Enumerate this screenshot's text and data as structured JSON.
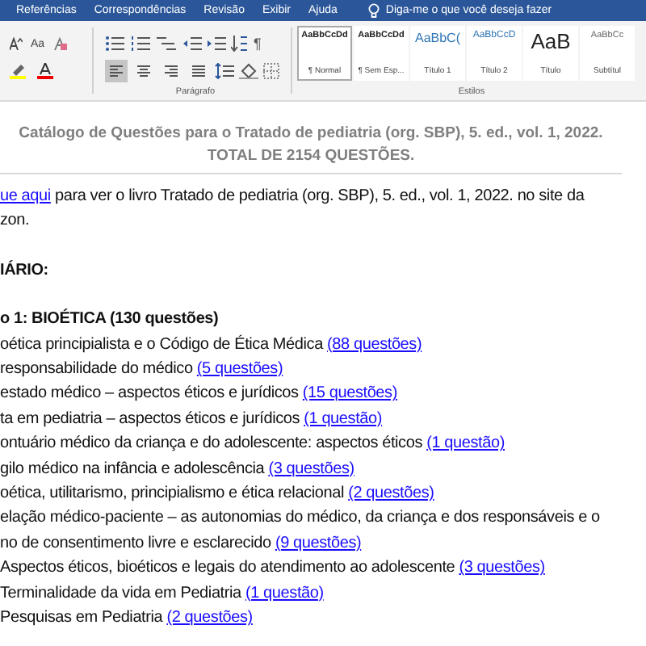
{
  "menu_tabs": [
    "Referências",
    "Correspondências",
    "Revisão",
    "Exibir",
    "Ajuda"
  ],
  "tell_me": {
    "placeholder": "Diga-me o que você deseja fazer"
  },
  "font_group": {
    "change_case": "Aa"
  },
  "paragraph_group": {
    "label": "Parágrafo",
    "show_marks": "¶",
    "alignment": [
      {
        "kind": "left",
        "selected": true
      },
      {
        "kind": "center",
        "selected": false
      },
      {
        "kind": "right",
        "selected": false
      },
      {
        "kind": "justify",
        "selected": false
      }
    ]
  },
  "styles_group": {
    "label": "Estilos",
    "items": [
      {
        "kind": "normal",
        "preview": "AaBbCcDd",
        "name": "¶ Normal",
        "selected": true
      },
      {
        "kind": "normal",
        "preview": "AaBbCcDd",
        "name": "¶ Sem Esp...",
        "selected": false
      },
      {
        "kind": "heading1",
        "preview": "AaBbC(",
        "name": "Título 1",
        "selected": false
      },
      {
        "kind": "heading2",
        "preview": "AaBbCcD",
        "name": "Título 2",
        "selected": false
      },
      {
        "kind": "title",
        "preview": "AaB",
        "name": "Título",
        "selected": false
      },
      {
        "kind": "subtitle",
        "preview": "AaBbCc",
        "name": "Subtítul",
        "selected": false
      }
    ]
  },
  "document": {
    "title_lines": [
      "Catálogo de Questões para o Tratado de pediatria (org. SBP), 5. ed., vol. 1, 2022.",
      "TOTAL DE 2154 QUESTÕES."
    ],
    "intro": {
      "link": "ue aqui",
      "text": " para ver o livro Tratado de pediatria (org. SBP), 5. ed., vol. 1, 2022. no site da",
      "continuation": "zon."
    },
    "summary_heading": "IÁRIO:",
    "chapter_heading": "o 1: BIOÉTICA (130 questões)",
    "entries": [
      {
        "text": "oética principialista e o Código de Ética Médica ",
        "link": "(88 questões)"
      },
      {
        "text": "responsabilidade do médico ",
        "link": "(5 questões)"
      },
      {
        "text": "estado médico – aspectos éticos e jurídicos ",
        "link": "(15 questões)"
      },
      {
        "text": "ta em pediatria – aspectos éticos e jurídicos ",
        "link": "(1 questão)"
      },
      {
        "text": "ontuário médico da criança e do adolescente: aspectos éticos ",
        "link": "(1 questão)"
      },
      {
        "text": "gilo médico na infância e adolescência ",
        "link": "(3 questões)"
      },
      {
        "text": "oética, utilitarismo, principialismo e ética relacional ",
        "link": "(2 questões)"
      },
      {
        "text": "elação médico-paciente – as autonomias do médico, da criança e dos responsáveis e o"
      },
      {
        "text": "no de consentimento livre e esclarecido ",
        "link": "(9 questões)"
      },
      {
        "text": "Aspectos éticos, bioéticos e legais do atendimento ao adolescente ",
        "link": "(3 questões)"
      },
      {
        "text": "Terminalidade da vida em Pediatria ",
        "link": "(1 questão)"
      },
      {
        "text": "Pesquisas em Pediatria ",
        "link": "(2 questões)"
      }
    ]
  }
}
